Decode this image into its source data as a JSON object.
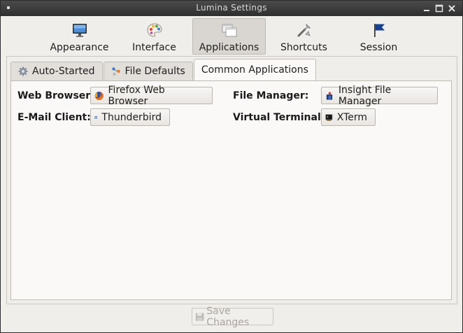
{
  "window": {
    "title": "Lumina Settings"
  },
  "toolbar": {
    "items": [
      {
        "label": "Appearance",
        "icon": "monitor-icon",
        "active": false
      },
      {
        "label": "Interface",
        "icon": "palette-icon",
        "active": false
      },
      {
        "label": "Applications",
        "icon": "windows-icon",
        "active": true
      },
      {
        "label": "Shortcuts",
        "icon": "tools-icon",
        "active": false
      },
      {
        "label": "Session",
        "icon": "flag-icon",
        "active": false
      }
    ]
  },
  "tabs": [
    {
      "label": "Auto-Started",
      "icon": "gear-icon",
      "active": false
    },
    {
      "label": "File Defaults",
      "icon": "file-associations-icon",
      "active": false
    },
    {
      "label": "Common Applications",
      "icon": "",
      "active": true
    }
  ],
  "common_apps": {
    "web_browser": {
      "label": "Web Browser:",
      "value": "Firefox Web Browser",
      "icon": "firefox-icon"
    },
    "email_client": {
      "label": "E-Mail Client:",
      "value": "Thunderbird",
      "icon": "thunderbird-icon"
    },
    "file_manager": {
      "label": "File Manager:",
      "value": "Insight File Manager",
      "icon": "file-manager-icon"
    },
    "terminal": {
      "label": "Virtual Terminal:",
      "value": "XTerm",
      "icon": "terminal-icon"
    }
  },
  "footer": {
    "save_label": "Save Changes",
    "save_enabled": false
  },
  "colors": {
    "titlebar": "#3a3a3a",
    "window_bg": "#f0eeeb",
    "panel_bg": "#faf9f7",
    "active_tool_bg": "#d9d6d1"
  }
}
